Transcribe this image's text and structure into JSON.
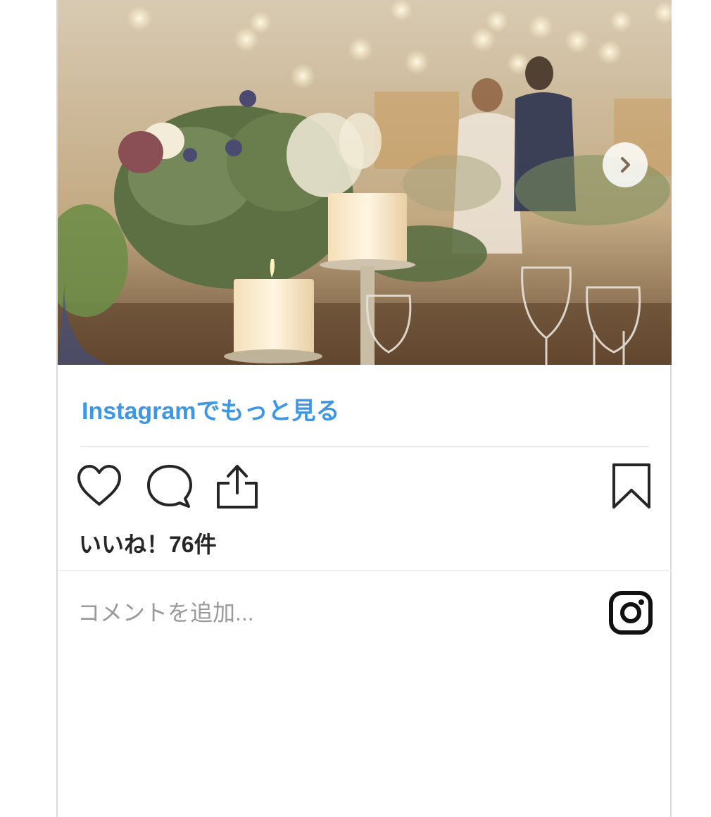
{
  "post": {
    "image_alt": "Wedding reception table with candles, flowers and glasses",
    "more_link": "Instagramでもっと見る",
    "likes": "いいね！76件"
  },
  "actions": {
    "like_icon": "heart-icon",
    "comment_icon": "comment-bubble-icon",
    "share_icon": "share-icon",
    "save_icon": "bookmark-icon",
    "next_icon": "chevron-right-icon"
  },
  "comment": {
    "placeholder": "コメントを追加...",
    "value": ""
  },
  "brand": {
    "logo_icon": "instagram-logo-icon",
    "link_color": "#3d97e5",
    "text_color": "#262626"
  }
}
